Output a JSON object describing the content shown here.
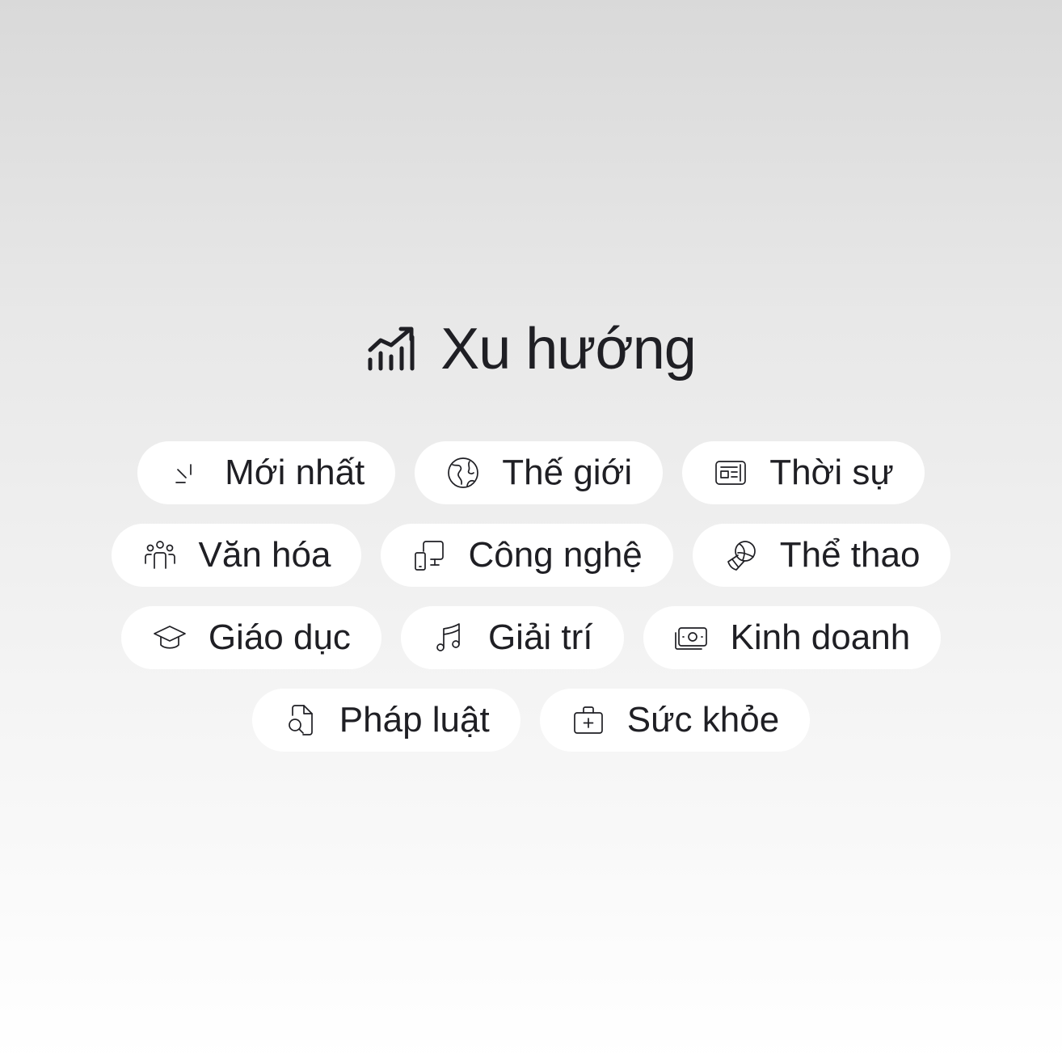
{
  "header": {
    "title": "Xu hướng",
    "icon": "trending-chart-icon"
  },
  "categories": [
    {
      "label": "Mới nhất",
      "icon": "new-sparkle-icon"
    },
    {
      "label": "Thế giới",
      "icon": "globe-icon"
    },
    {
      "label": "Thời sự",
      "icon": "newspaper-icon"
    },
    {
      "label": "Văn hóa",
      "icon": "people-group-icon"
    },
    {
      "label": "Công nghệ",
      "icon": "devices-icon"
    },
    {
      "label": "Thể thao",
      "icon": "sports-ball-icon"
    },
    {
      "label": "Giáo dục",
      "icon": "graduation-cap-icon"
    },
    {
      "label": "Giải trí",
      "icon": "music-note-icon"
    },
    {
      "label": "Kinh doanh",
      "icon": "money-icon"
    },
    {
      "label": "Pháp luật",
      "icon": "document-search-icon"
    },
    {
      "label": "Sức khỏe",
      "icon": "medical-kit-icon"
    }
  ],
  "colors": {
    "text": "#1f1f24",
    "pill_background": "#ffffff",
    "background_top": "#d9d9d9",
    "background_bottom": "#ffffff"
  }
}
